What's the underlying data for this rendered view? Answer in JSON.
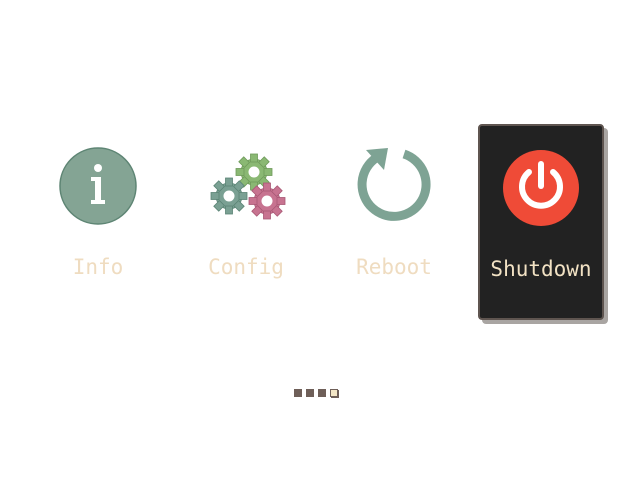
{
  "menu": {
    "items": [
      {
        "label": "Info",
        "icon": "info-icon",
        "selected": false
      },
      {
        "label": "Config",
        "icon": "gears-icon",
        "selected": false
      },
      {
        "label": "Reboot",
        "icon": "refresh-icon",
        "selected": false
      },
      {
        "label": "Shutdown",
        "icon": "power-icon",
        "selected": true
      }
    ]
  },
  "pager": {
    "total": 4,
    "active": 4
  },
  "colors": {
    "label": "#efdcc0",
    "selected_bg": "#222222",
    "teal": "#7ea394",
    "green": "#8ab873",
    "pink": "#c77390",
    "power_red": "#ef4b37",
    "pager_dot": "#6e5f58"
  }
}
